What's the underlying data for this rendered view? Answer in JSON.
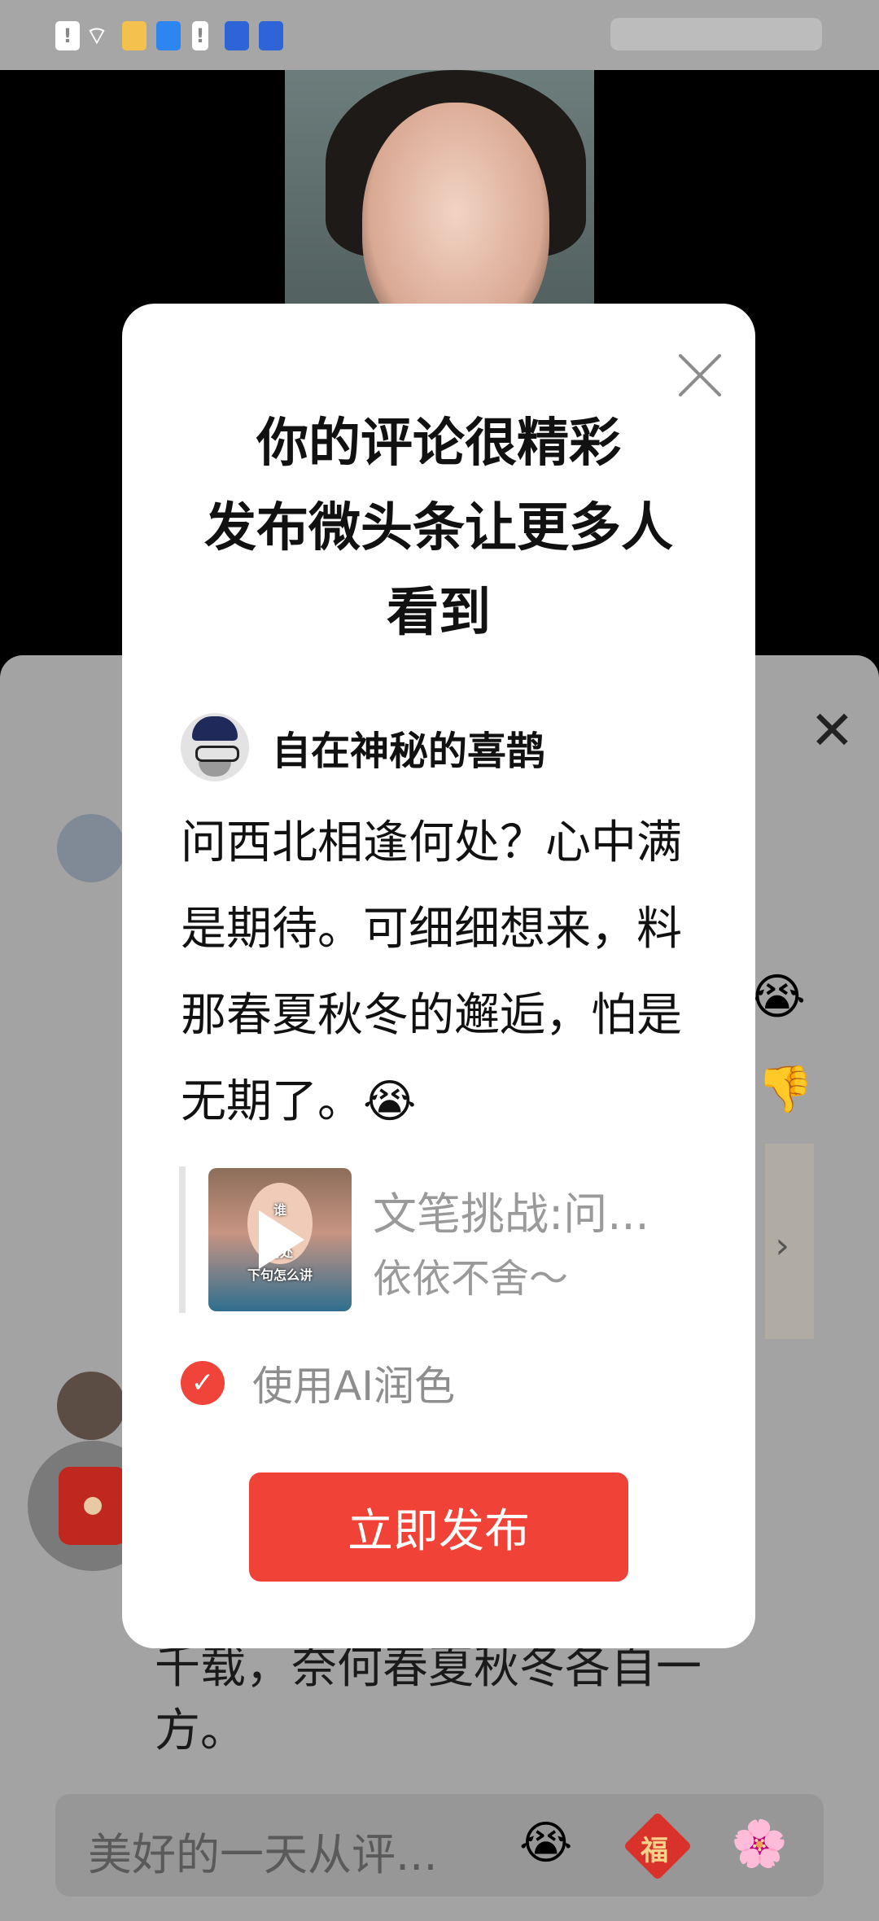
{
  "status_bar": {
    "icons": [
      "alert-icon",
      "wifi-icon",
      "app-icon-1",
      "app-icon-2",
      "alert-icon",
      "shield-icon",
      "shield-icon"
    ]
  },
  "modal": {
    "title_line1": "你的评论很精彩",
    "title_line2": "发布微头条让更多人",
    "title_line3": "看到",
    "author_name": "自在神秘的喜鹊",
    "comment_text": "问西北相逢何处？心中满是期待。可细细想来，料那春夏秋冬的邂逅，怕是无期了。😭",
    "quote_title": "文笔挑战:问...",
    "quote_subtitle": "依依不舍～",
    "ai_option_label": "使用AI润色",
    "ai_option_checked": true,
    "publish_button": "立即发布",
    "accent_color": "#f14238"
  },
  "background": {
    "comment_tail_line1": "千载，奈何春夏秋冬各自一",
    "comment_tail_line2": "方。",
    "input_placeholder": "美好的一天从评...",
    "fu_char": "福"
  }
}
